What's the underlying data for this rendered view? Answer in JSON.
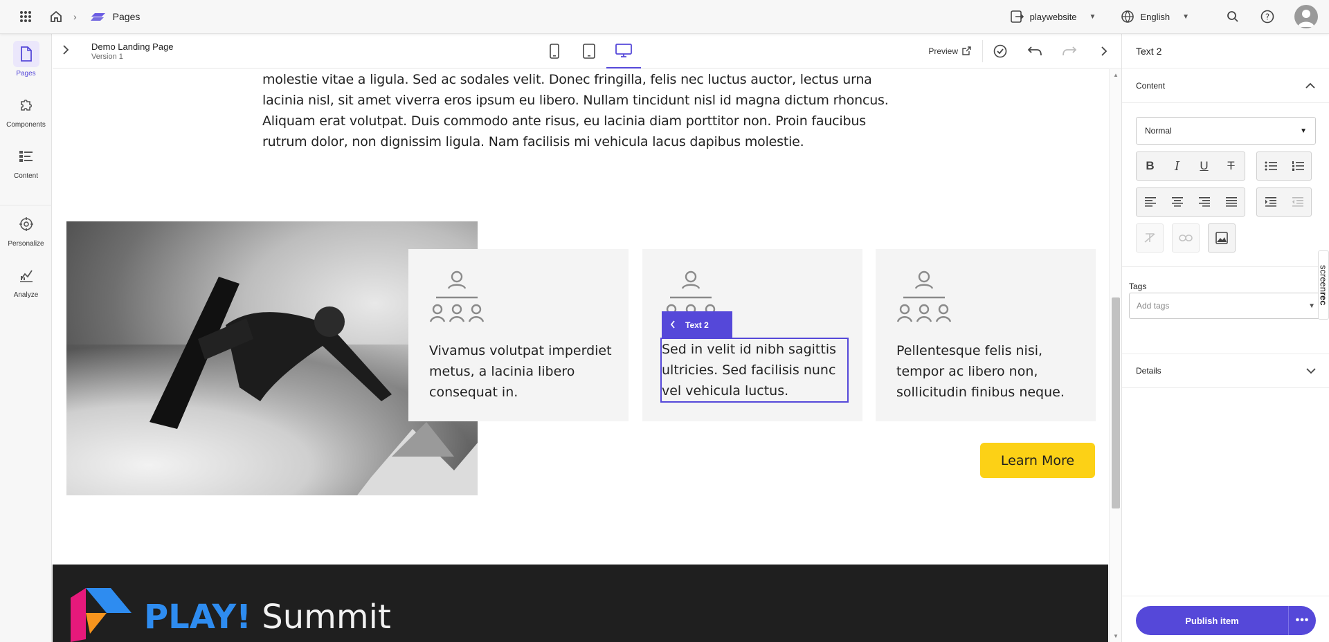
{
  "topbar": {
    "breadcrumb_app": "Pages",
    "site": "playwebsite",
    "language": "English"
  },
  "rail": {
    "items": [
      {
        "label": "Pages",
        "icon": "page-icon"
      },
      {
        "label": "Components",
        "icon": "puzzle-icon"
      },
      {
        "label": "Content",
        "icon": "list-icon"
      },
      {
        "label": "Personalize",
        "icon": "target-icon"
      },
      {
        "label": "Analyze",
        "icon": "chart-icon"
      }
    ]
  },
  "editor": {
    "page_title": "Demo Landing Page",
    "version": "Version 1",
    "preview_label": "Preview"
  },
  "canvas": {
    "paragraph": "molestie vitae a ligula. Sed ac sodales velit. Donec fringilla, felis nec luctus auctor, lectus urna lacinia nisl, sit amet viverra eros ipsum eu libero. Nullam tincidunt nisl id magna dictum rhoncus. Aliquam erat volutpat. Duis commodo ante risus, eu lacinia diam porttitor non. Proin faucibus rutrum dolor, non dignissim ligula. Nam facilisis mi vehicula lacus dapibus molestie.",
    "cards": [
      {
        "text": "Vivamus volutpat imperdiet metus, a lacinia libero consequat in."
      },
      {
        "text": "Sed in velit id nibh sagittis ultricies. Sed facilisis nunc vel vehicula luctus."
      },
      {
        "text": "Pellentesque felis nisi, tempor ac libero non, sollicitudin finibus neque."
      }
    ],
    "selected_tag": "Text 2",
    "learn_more": "Learn More",
    "footer_brand_bold": "PLAY!",
    "footer_brand_light": "Summit"
  },
  "panel": {
    "title": "Text 2",
    "content_section": "Content",
    "format_select": "Normal",
    "tags_label": "Tags",
    "tags_placeholder": "Add tags",
    "details_section": "Details",
    "publish_label": "Publish item",
    "more_label": "•••"
  },
  "overlay": {
    "screenrec_light": "screen",
    "screenrec_bold": "rec"
  },
  "colors": {
    "accent": "#5548d9",
    "cta": "#fcd116",
    "footer_bg": "#1f1f1f",
    "brand_blue": "#2e8cf0"
  }
}
